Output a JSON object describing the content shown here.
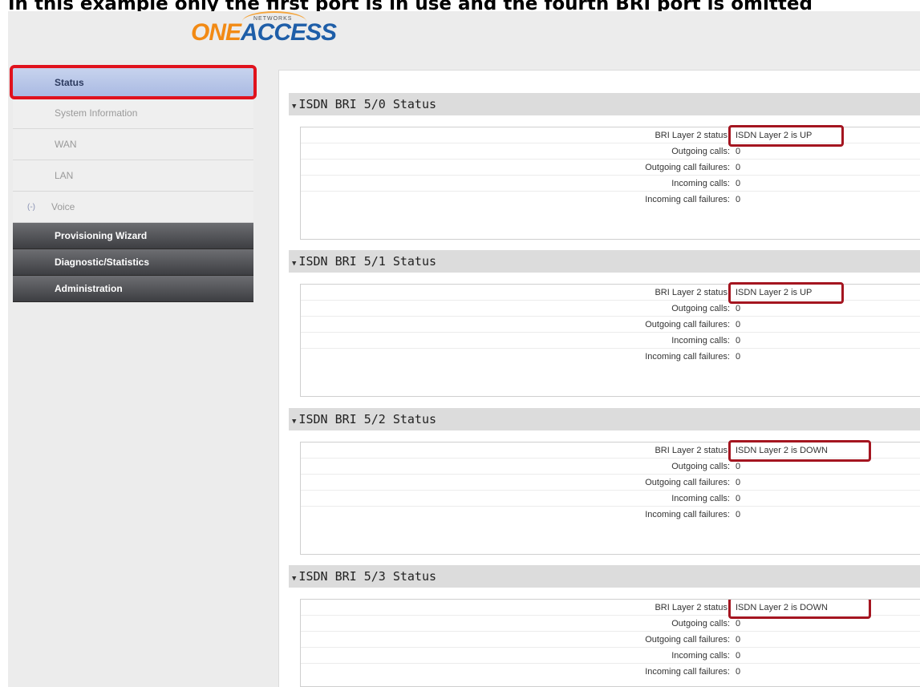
{
  "caption": "In this example only the first port is in use and the fourth BRI port is omitted",
  "logo": {
    "brand": "ONEACCESS",
    "one": "ONE",
    "access": "ACCESS",
    "networks": "NETWORKS"
  },
  "sidebar": {
    "items": [
      {
        "label": "Status",
        "style": "active"
      },
      {
        "label": "System Information",
        "style": "sub"
      },
      {
        "label": "WAN",
        "style": "sub"
      },
      {
        "label": "LAN",
        "style": "sub"
      },
      {
        "label": "Voice",
        "style": "sub",
        "toggle": "(-)"
      },
      {
        "label": "Provisioning Wizard",
        "style": "dark"
      },
      {
        "label": "Diagnostic/Statistics",
        "style": "dark"
      },
      {
        "label": "Administration",
        "style": "dark"
      }
    ]
  },
  "sections": [
    {
      "title": "ISDN BRI 5/0 Status",
      "rows": [
        {
          "label": "BRI Layer 2 status:",
          "value": "ISDN Layer 2 is UP"
        },
        {
          "label": "Outgoing calls:",
          "value": "0"
        },
        {
          "label": "Outgoing call failures:",
          "value": "0"
        },
        {
          "label": "Incoming calls:",
          "value": "0"
        },
        {
          "label": "Incoming call failures:",
          "value": "0"
        }
      ]
    },
    {
      "title": "ISDN BRI 5/1 Status",
      "rows": [
        {
          "label": "BRI Layer 2 status:",
          "value": "ISDN Layer 2 is UP"
        },
        {
          "label": "Outgoing calls:",
          "value": "0"
        },
        {
          "label": "Outgoing call failures:",
          "value": "0"
        },
        {
          "label": "Incoming calls:",
          "value": "0"
        },
        {
          "label": "Incoming call failures:",
          "value": "0"
        }
      ]
    },
    {
      "title": "ISDN BRI 5/2 Status",
      "rows": [
        {
          "label": "BRI Layer 2 status:",
          "value": "ISDN Layer 2 is DOWN"
        },
        {
          "label": "Outgoing calls:",
          "value": "0"
        },
        {
          "label": "Outgoing call failures:",
          "value": "0"
        },
        {
          "label": "Incoming calls:",
          "value": "0"
        },
        {
          "label": "Incoming call failures:",
          "value": "0"
        }
      ]
    },
    {
      "title": "ISDN BRI 5/3 Status",
      "rows": [
        {
          "label": "BRI Layer 2 status:",
          "value": "ISDN Layer 2 is DOWN"
        },
        {
          "label": "Outgoing calls:",
          "value": "0"
        },
        {
          "label": "Outgoing call failures:",
          "value": "0"
        },
        {
          "label": "Incoming calls:",
          "value": "0"
        },
        {
          "label": "Incoming call failures:",
          "value": "0"
        }
      ]
    }
  ],
  "colors": {
    "highlight_red": "#e0121d",
    "highlight_dark_red": "#a41520",
    "active_nav": "#b5c3e7",
    "dark_nav": "#4a4b4f"
  }
}
